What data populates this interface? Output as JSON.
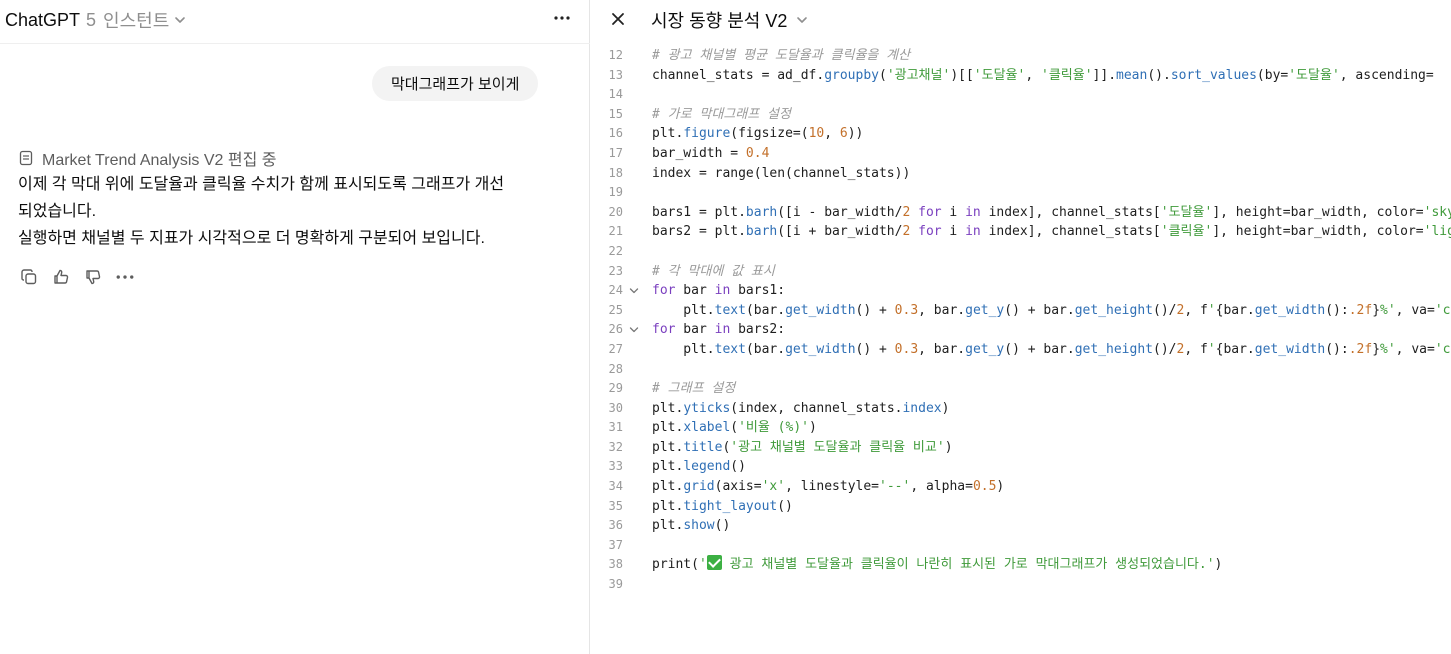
{
  "chat": {
    "model_name": "ChatGPT",
    "model_version": "5",
    "model_variant": "인스턴트",
    "user_message": "막대그래프가 보이게",
    "edit_status": "Market Trend Analysis V2 편집 중",
    "assistant_lines": [
      "이제 각 막대 위에 도달율과 클릭율 수치가 함께 표시되도록 그래프가 개선",
      "되었습니다.",
      "실행하면 채널별 두 지표가 시각적으로 더 명확하게 구분되어 보입니다."
    ]
  },
  "canvas": {
    "title": "시장 동향 분석 V2",
    "lines": [
      {
        "n": "12",
        "fold": false,
        "tokens": [
          [
            "com",
            "# 광고 채널별 평균 도달율과 클릭율을 계산"
          ]
        ]
      },
      {
        "n": "13",
        "fold": false,
        "tokens": [
          [
            "txt",
            "channel_stats = ad_df."
          ],
          [
            "fn",
            "groupby"
          ],
          [
            "txt",
            "("
          ],
          [
            "str",
            "'광고채널'"
          ],
          [
            "txt",
            ")[["
          ],
          [
            "str",
            "'도달율'"
          ],
          [
            "txt",
            ", "
          ],
          [
            "str",
            "'클릭율'"
          ],
          [
            "txt",
            "]]."
          ],
          [
            "fn",
            "mean"
          ],
          [
            "txt",
            "()."
          ],
          [
            "fn",
            "sort_values"
          ],
          [
            "txt",
            "(by="
          ],
          [
            "str",
            "'도달율'"
          ],
          [
            "txt",
            ", ascending="
          ]
        ]
      },
      {
        "n": "14",
        "fold": false,
        "tokens": []
      },
      {
        "n": "15",
        "fold": false,
        "tokens": [
          [
            "com",
            "# 가로 막대그래프 설정"
          ]
        ]
      },
      {
        "n": "16",
        "fold": false,
        "tokens": [
          [
            "txt",
            "plt."
          ],
          [
            "fn",
            "figure"
          ],
          [
            "txt",
            "(figsize=("
          ],
          [
            "num",
            "10"
          ],
          [
            "txt",
            ", "
          ],
          [
            "num",
            "6"
          ],
          [
            "txt",
            "))"
          ]
        ]
      },
      {
        "n": "17",
        "fold": false,
        "tokens": [
          [
            "txt",
            "bar_width = "
          ],
          [
            "num",
            "0.4"
          ]
        ]
      },
      {
        "n": "18",
        "fold": false,
        "tokens": [
          [
            "txt",
            "index = range(len(channel_stats))"
          ]
        ]
      },
      {
        "n": "19",
        "fold": false,
        "tokens": []
      },
      {
        "n": "20",
        "fold": false,
        "tokens": [
          [
            "txt",
            "bars1 = plt."
          ],
          [
            "fn",
            "barh"
          ],
          [
            "txt",
            "([i - bar_width/"
          ],
          [
            "num",
            "2"
          ],
          [
            "txt",
            " "
          ],
          [
            "kw",
            "for"
          ],
          [
            "txt",
            " i "
          ],
          [
            "kw",
            "in"
          ],
          [
            "txt",
            " index], channel_stats["
          ],
          [
            "str",
            "'도달율'"
          ],
          [
            "txt",
            "], height=bar_width, color="
          ],
          [
            "str",
            "'skyb"
          ]
        ]
      },
      {
        "n": "21",
        "fold": false,
        "tokens": [
          [
            "txt",
            "bars2 = plt."
          ],
          [
            "fn",
            "barh"
          ],
          [
            "txt",
            "([i + bar_width/"
          ],
          [
            "num",
            "2"
          ],
          [
            "txt",
            " "
          ],
          [
            "kw",
            "for"
          ],
          [
            "txt",
            " i "
          ],
          [
            "kw",
            "in"
          ],
          [
            "txt",
            " index], channel_stats["
          ],
          [
            "str",
            "'클릭율'"
          ],
          [
            "txt",
            "], height=bar_width, color="
          ],
          [
            "str",
            "'ligh"
          ]
        ]
      },
      {
        "n": "22",
        "fold": false,
        "tokens": []
      },
      {
        "n": "23",
        "fold": false,
        "tokens": [
          [
            "com",
            "# 각 막대에 값 표시"
          ]
        ]
      },
      {
        "n": "24",
        "fold": true,
        "tokens": [
          [
            "kw",
            "for"
          ],
          [
            "txt",
            " bar "
          ],
          [
            "kw",
            "in"
          ],
          [
            "txt",
            " bars1:"
          ]
        ]
      },
      {
        "n": "25",
        "fold": false,
        "tokens": [
          [
            "txt",
            "    plt."
          ],
          [
            "fn",
            "text"
          ],
          [
            "txt",
            "(bar."
          ],
          [
            "fn",
            "get_width"
          ],
          [
            "txt",
            "() + "
          ],
          [
            "num",
            "0.3"
          ],
          [
            "txt",
            ", bar."
          ],
          [
            "fn",
            "get_y"
          ],
          [
            "txt",
            "() + bar."
          ],
          [
            "fn",
            "get_height"
          ],
          [
            "txt",
            "()/"
          ],
          [
            "num",
            "2"
          ],
          [
            "txt",
            ", f"
          ],
          [
            "str",
            "'"
          ],
          [
            "txt",
            "{bar."
          ],
          [
            "fn",
            "get_width"
          ],
          [
            "txt",
            "():"
          ],
          [
            "num",
            ".2f"
          ],
          [
            "txt",
            "}"
          ],
          [
            "str",
            "%'"
          ],
          [
            "txt",
            ", va="
          ],
          [
            "str",
            "'cen"
          ]
        ]
      },
      {
        "n": "26",
        "fold": true,
        "tokens": [
          [
            "kw",
            "for"
          ],
          [
            "txt",
            " bar "
          ],
          [
            "kw",
            "in"
          ],
          [
            "txt",
            " bars2:"
          ]
        ]
      },
      {
        "n": "27",
        "fold": false,
        "tokens": [
          [
            "txt",
            "    plt."
          ],
          [
            "fn",
            "text"
          ],
          [
            "txt",
            "(bar."
          ],
          [
            "fn",
            "get_width"
          ],
          [
            "txt",
            "() + "
          ],
          [
            "num",
            "0.3"
          ],
          [
            "txt",
            ", bar."
          ],
          [
            "fn",
            "get_y"
          ],
          [
            "txt",
            "() + bar."
          ],
          [
            "fn",
            "get_height"
          ],
          [
            "txt",
            "()/"
          ],
          [
            "num",
            "2"
          ],
          [
            "txt",
            ", f"
          ],
          [
            "str",
            "'"
          ],
          [
            "txt",
            "{bar."
          ],
          [
            "fn",
            "get_width"
          ],
          [
            "txt",
            "():"
          ],
          [
            "num",
            ".2f"
          ],
          [
            "txt",
            "}"
          ],
          [
            "str",
            "%'"
          ],
          [
            "txt",
            ", va="
          ],
          [
            "str",
            "'cen"
          ]
        ]
      },
      {
        "n": "28",
        "fold": false,
        "tokens": []
      },
      {
        "n": "29",
        "fold": false,
        "tokens": [
          [
            "com",
            "# 그래프 설정"
          ]
        ]
      },
      {
        "n": "30",
        "fold": false,
        "tokens": [
          [
            "txt",
            "plt."
          ],
          [
            "fn",
            "yticks"
          ],
          [
            "txt",
            "(index, channel_stats."
          ],
          [
            "fn",
            "index"
          ],
          [
            "txt",
            ")"
          ]
        ]
      },
      {
        "n": "31",
        "fold": false,
        "tokens": [
          [
            "txt",
            "plt."
          ],
          [
            "fn",
            "xlabel"
          ],
          [
            "txt",
            "("
          ],
          [
            "str",
            "'비율 (%)'"
          ],
          [
            "txt",
            ")"
          ]
        ]
      },
      {
        "n": "32",
        "fold": false,
        "tokens": [
          [
            "txt",
            "plt."
          ],
          [
            "fn",
            "title"
          ],
          [
            "txt",
            "("
          ],
          [
            "str",
            "'광고 채널별 도달율과 클릭율 비교'"
          ],
          [
            "txt",
            ")"
          ]
        ]
      },
      {
        "n": "33",
        "fold": false,
        "tokens": [
          [
            "txt",
            "plt."
          ],
          [
            "fn",
            "legend"
          ],
          [
            "txt",
            "()"
          ]
        ]
      },
      {
        "n": "34",
        "fold": false,
        "tokens": [
          [
            "txt",
            "plt."
          ],
          [
            "fn",
            "grid"
          ],
          [
            "txt",
            "(axis="
          ],
          [
            "str",
            "'x'"
          ],
          [
            "txt",
            ", linestyle="
          ],
          [
            "str",
            "'--'"
          ],
          [
            "txt",
            ", alpha="
          ],
          [
            "num",
            "0.5"
          ],
          [
            "txt",
            ")"
          ]
        ]
      },
      {
        "n": "35",
        "fold": false,
        "tokens": [
          [
            "txt",
            "plt."
          ],
          [
            "fn",
            "tight_layout"
          ],
          [
            "txt",
            "()"
          ]
        ]
      },
      {
        "n": "36",
        "fold": false,
        "tokens": [
          [
            "txt",
            "plt."
          ],
          [
            "fn",
            "show"
          ],
          [
            "txt",
            "()"
          ]
        ]
      },
      {
        "n": "37",
        "fold": false,
        "tokens": []
      },
      {
        "n": "38",
        "fold": false,
        "tokens": [
          [
            "txt",
            "print("
          ],
          [
            "str",
            "'"
          ],
          [
            "emoji",
            ""
          ],
          [
            "str",
            " 광고 채널별 도달율과 클릭율이 나란히 표시된 가로 막대그래프가 생성되었습니다.'"
          ],
          [
            "txt",
            ")"
          ]
        ]
      },
      {
        "n": "39",
        "fold": false,
        "tokens": []
      }
    ]
  }
}
